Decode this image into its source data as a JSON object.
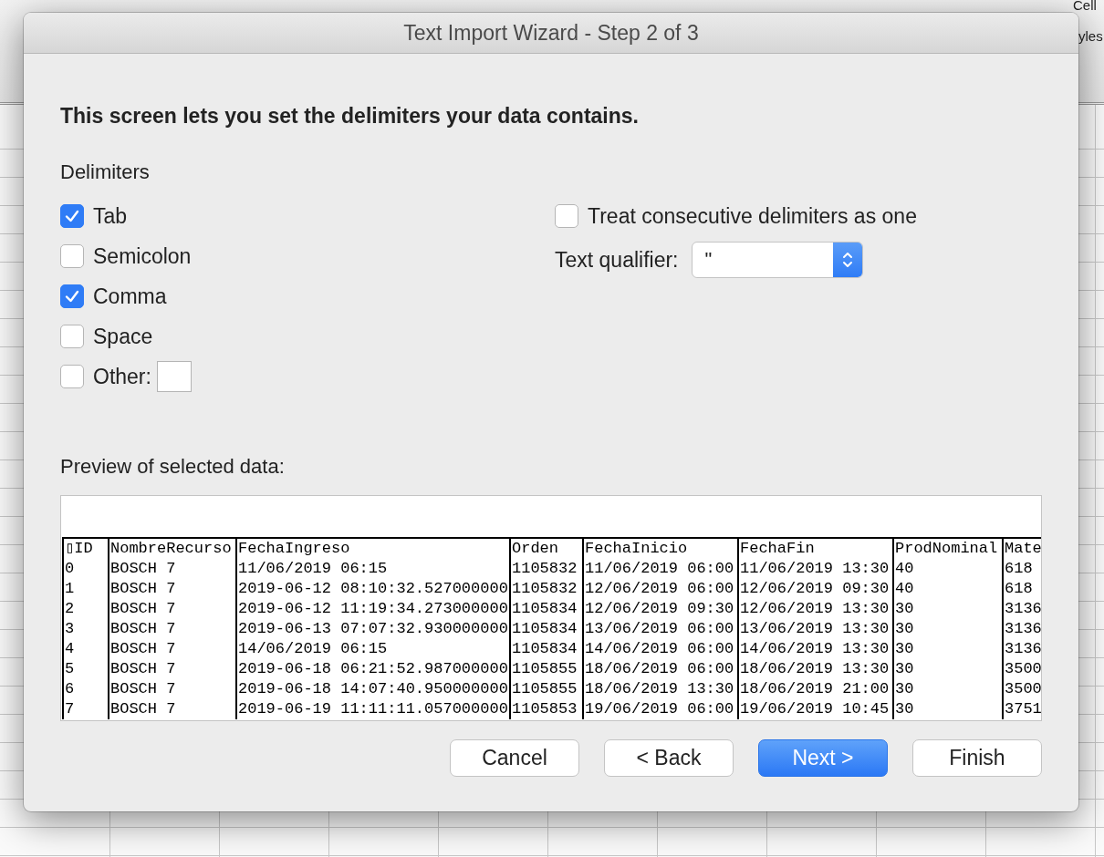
{
  "background": {
    "toolbar_texts": [
      "Cell",
      "yles"
    ]
  },
  "dialog": {
    "title": "Text Import Wizard - Step 2 of 3",
    "heading": "This screen lets you set the delimiters your data contains.",
    "delimiters": {
      "label": "Delimiters",
      "options": [
        {
          "label": "Tab",
          "checked": true,
          "kind": "checkbox"
        },
        {
          "label": "Semicolon",
          "checked": false,
          "kind": "checkbox"
        },
        {
          "label": "Comma",
          "checked": true,
          "kind": "checkbox"
        },
        {
          "label": "Space",
          "checked": false,
          "kind": "checkbox"
        },
        {
          "label": "Other:",
          "checked": false,
          "kind": "checkbox_field"
        }
      ]
    },
    "consecutive": {
      "label": "Treat consecutive delimiters as one",
      "checked": false
    },
    "text_qualifier": {
      "label": "Text qualifier:",
      "value": "\""
    },
    "preview": {
      "label": "Preview of selected data:",
      "columns": [
        "▯ID",
        "NombreRecurso",
        "FechaIngreso",
        "Orden",
        "FechaInicio",
        "FechaFin",
        "ProdNominal",
        "Mate"
      ],
      "rows": [
        [
          "0",
          "BOSCH 7",
          "11/06/2019 06:15",
          "1105832",
          "11/06/2019 06:00",
          "11/06/2019 13:30",
          "40",
          "618"
        ],
        [
          "1",
          "BOSCH 7",
          "2019-06-12 08:10:32.527000000",
          "1105832",
          "12/06/2019 06:00",
          "12/06/2019 09:30",
          "40",
          "618"
        ],
        [
          "2",
          "BOSCH 7",
          "2019-06-12 11:19:34.273000000",
          "1105834",
          "12/06/2019 09:30",
          "12/06/2019 13:30",
          "30",
          "3136"
        ],
        [
          "3",
          "BOSCH 7",
          "2019-06-13 07:07:32.930000000",
          "1105834",
          "13/06/2019 06:00",
          "13/06/2019 13:30",
          "30",
          "3136"
        ],
        [
          "4",
          "BOSCH 7",
          "14/06/2019 06:15",
          "1105834",
          "14/06/2019 06:00",
          "14/06/2019 13:30",
          "30",
          "3136"
        ],
        [
          "5",
          "BOSCH 7",
          "2019-06-18 06:21:52.987000000",
          "1105855",
          "18/06/2019 06:00",
          "18/06/2019 13:30",
          "30",
          "3500"
        ],
        [
          "6",
          "BOSCH 7",
          "2019-06-18 14:07:40.950000000",
          "1105855",
          "18/06/2019 13:30",
          "18/06/2019 21:00",
          "30",
          "3500"
        ],
        [
          "7",
          "BOSCH 7",
          "2019-06-19 11:11:11.057000000",
          "1105853",
          "19/06/2019 06:00",
          "19/06/2019 10:45",
          "30",
          "3751"
        ]
      ]
    },
    "buttons": [
      {
        "label": "Cancel",
        "default": false
      },
      {
        "label": "< Back",
        "default": false
      },
      {
        "label": "Next >",
        "default": true
      },
      {
        "label": "Finish",
        "default": false
      }
    ]
  }
}
